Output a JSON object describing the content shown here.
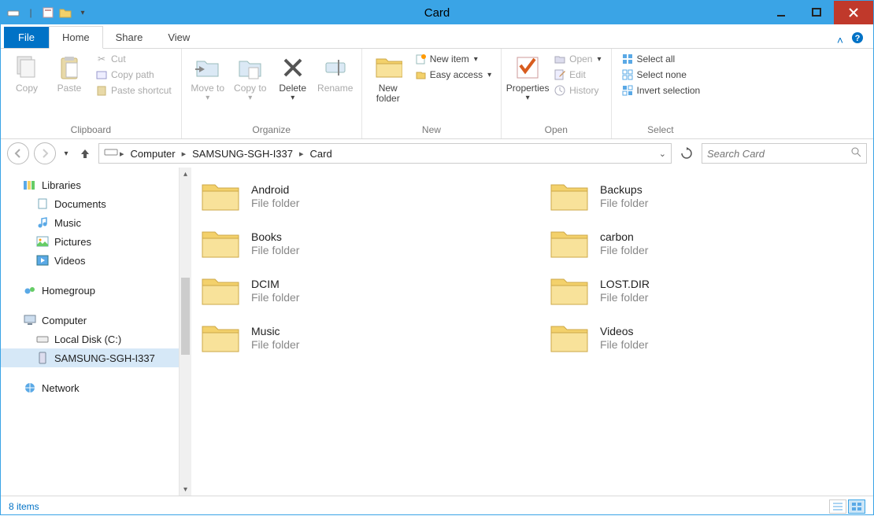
{
  "window": {
    "title": "Card",
    "qa_items": "▾"
  },
  "tabs": {
    "file": "File",
    "home": "Home",
    "share": "Share",
    "view": "View"
  },
  "ribbon": {
    "clipboard": {
      "label": "Clipboard",
      "copy": "Copy",
      "paste": "Paste",
      "cut": "Cut",
      "copy_path": "Copy path",
      "paste_shortcut": "Paste shortcut"
    },
    "organize": {
      "label": "Organize",
      "move_to": "Move to",
      "copy_to": "Copy to",
      "delete": "Delete",
      "rename": "Rename"
    },
    "new": {
      "label": "New",
      "new_folder": "New folder",
      "new_item": "New item",
      "easy_access": "Easy access"
    },
    "open": {
      "label": "Open",
      "properties": "Properties",
      "open": "Open",
      "edit": "Edit",
      "history": "History"
    },
    "select": {
      "label": "Select",
      "select_all": "Select all",
      "select_none": "Select none",
      "invert": "Invert selection"
    }
  },
  "address": {
    "crumbs": [
      "Computer",
      "SAMSUNG-SGH-I337",
      "Card"
    ]
  },
  "search": {
    "placeholder": "Search Card"
  },
  "sidebar": {
    "libraries": "Libraries",
    "documents": "Documents",
    "music": "Music",
    "pictures": "Pictures",
    "videos": "Videos",
    "homegroup": "Homegroup",
    "computer": "Computer",
    "local_disk": "Local Disk (C:)",
    "samsung": "SAMSUNG-SGH-I337",
    "network": "Network"
  },
  "items": [
    {
      "name": "Android",
      "type": "File folder"
    },
    {
      "name": "Backups",
      "type": "File folder"
    },
    {
      "name": "Books",
      "type": "File folder"
    },
    {
      "name": "carbon",
      "type": "File folder"
    },
    {
      "name": "DCIM",
      "type": "File folder"
    },
    {
      "name": "LOST.DIR",
      "type": "File folder"
    },
    {
      "name": "Music",
      "type": "File folder"
    },
    {
      "name": "Videos",
      "type": "File folder"
    }
  ],
  "status": {
    "count": "8 items"
  }
}
